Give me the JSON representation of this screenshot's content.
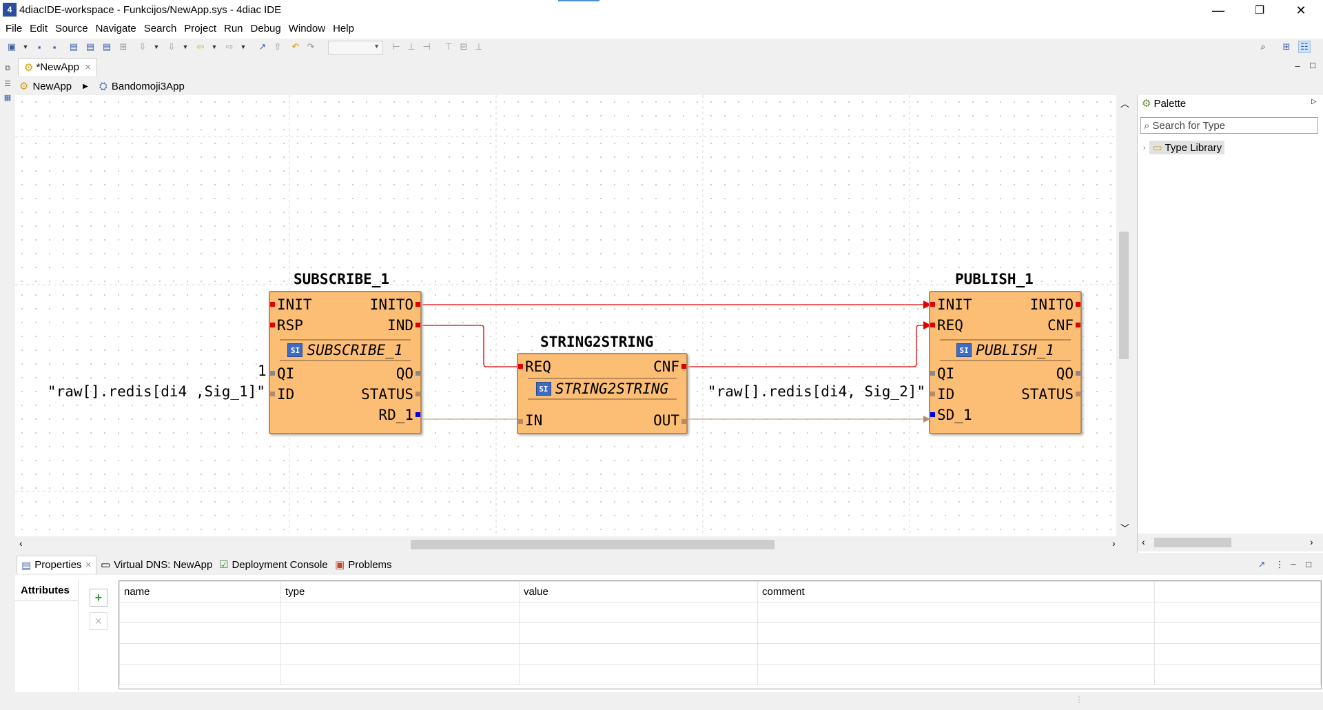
{
  "window": {
    "title": "4diacIDE-workspace - Funkcijos/NewApp.sys - 4diac IDE",
    "app_icon": "4diac-logo-icon",
    "minimize": "—",
    "restore": "❐",
    "close": "✕"
  },
  "menu": [
    "File",
    "Edit",
    "Source",
    "Navigate",
    "Search",
    "Project",
    "Run",
    "Debug",
    "Window",
    "Help"
  ],
  "editor": {
    "tab_label": "*NewApp",
    "breadcrumb": [
      "NewApp",
      "Bandomoji3App"
    ]
  },
  "blocks": {
    "subscribe": {
      "name": "SUBSCRIBE_1",
      "type": "SUBSCRIBE_1",
      "event_inputs": [
        "INIT",
        "RSP"
      ],
      "event_outputs": [
        "INITO",
        "IND"
      ],
      "data_inputs": [
        "QI",
        "ID"
      ],
      "data_outputs": [
        "QO",
        "STATUS",
        "RD_1"
      ],
      "params": {
        "QI": "1",
        "ID": "\"raw[].redis[di4 ,Sig_1]\""
      }
    },
    "string2string": {
      "name": "STRING2STRING",
      "type": "STRING2STRING",
      "event_inputs": [
        "REQ"
      ],
      "event_outputs": [
        "CNF"
      ],
      "data_inputs": [
        "IN"
      ],
      "data_outputs": [
        "OUT"
      ]
    },
    "publish": {
      "name": "PUBLISH_1",
      "type": "PUBLISH_1",
      "event_inputs": [
        "INIT",
        "REQ"
      ],
      "event_outputs": [
        "INITO",
        "CNF"
      ],
      "data_inputs": [
        "QI",
        "ID",
        "SD_1"
      ],
      "data_outputs": [
        "QO",
        "STATUS"
      ],
      "params": {
        "ID": "\"raw[].redis[di4, Sig_2]\""
      }
    }
  },
  "colors": {
    "block_fill": "#fcbd74",
    "event_pin": "#e00000",
    "data_pin_string": "#b58b6b",
    "data_pin_any": "#0000e6",
    "event_line": "#e00000",
    "data_line": "#c8a890"
  },
  "palette": {
    "title": "Palette",
    "search_placeholder": "Search for Type",
    "tree_root": "Type Library"
  },
  "bottom_tabs": [
    "Properties",
    "Virtual DNS: NewApp",
    "Deployment Console",
    "Problems"
  ],
  "properties": {
    "section": "Attributes",
    "columns": [
      "name",
      "type",
      "value",
      "comment"
    ]
  }
}
